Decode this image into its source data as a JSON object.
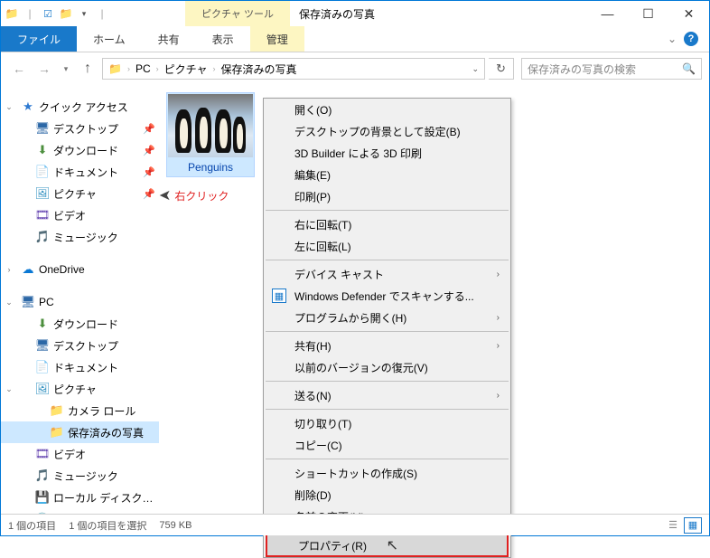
{
  "titlebar": {
    "picture_tools": "ピクチャ ツール",
    "window_title": "保存済みの写真"
  },
  "ribbon": {
    "file": "ファイル",
    "home": "ホーム",
    "share": "共有",
    "view": "表示",
    "manage": "管理"
  },
  "breadcrumb": {
    "p0": "PC",
    "p1": "ピクチャ",
    "p2": "保存済みの写真"
  },
  "search": {
    "placeholder": "保存済みの写真の検索"
  },
  "tree": {
    "quick_access": "クイック アクセス",
    "desktop": "デスクトップ",
    "downloads": "ダウンロード",
    "documents": "ドキュメント",
    "pictures": "ピクチャ",
    "videos": "ビデオ",
    "music": "ミュージック",
    "onedrive": "OneDrive",
    "pc": "PC",
    "cameraroll": "カメラ ロール",
    "savedpictures": "保存済みの写真",
    "localdisk": "ローカル ディスク (C:)",
    "cddrive": "CD ドライブ (D:) Vi"
  },
  "thumbnail": {
    "filename": "Penguins"
  },
  "annotation": {
    "text": "右クリック"
  },
  "ctx": {
    "open": "開く(O)",
    "set_bg": "デスクトップの背景として設定(B)",
    "print3d": "3D Builder による 3D 印刷",
    "edit": "編集(E)",
    "print": "印刷(P)",
    "rotate_r": "右に回転(T)",
    "rotate_l": "左に回転(L)",
    "cast": "デバイス キャスト",
    "defender": "Windows Defender でスキャンする...",
    "openwith": "プログラムから開く(H)",
    "share": "共有(H)",
    "restore": "以前のバージョンの復元(V)",
    "sendto": "送る(N)",
    "cut": "切り取り(T)",
    "copy": "コピー(C)",
    "shortcut": "ショートカットの作成(S)",
    "delete": "削除(D)",
    "rename": "名前の変更(M)",
    "properties": "プロパティ(R)"
  },
  "status": {
    "count": "1 個の項目",
    "selection": "1 個の項目を選択",
    "size": "759 KB"
  }
}
